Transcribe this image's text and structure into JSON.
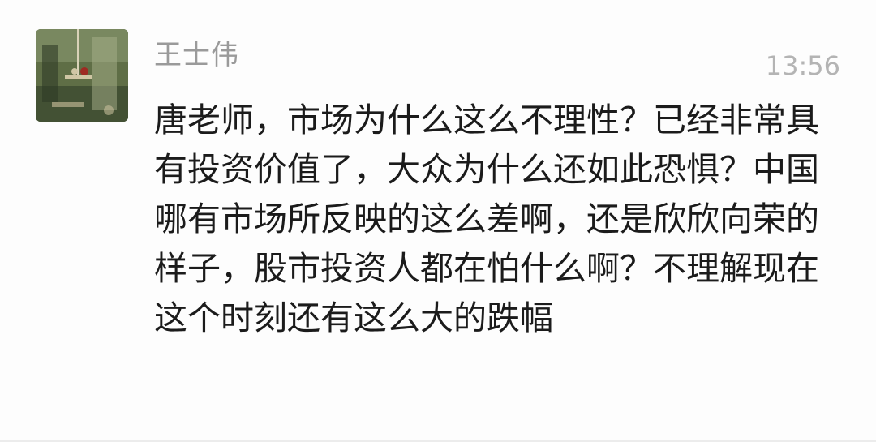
{
  "message": {
    "sender": "王士伟",
    "time": "13:56",
    "text": "唐老师，市场为什么这么不理性？已经非常具有投资价值了，大众为什么还如此恐惧？中国哪有市场所反映的这么差啊，还是欣欣向荣的样子，股市投资人都在怕什么啊？不理解现在这个时刻还有这么大的跌幅"
  }
}
